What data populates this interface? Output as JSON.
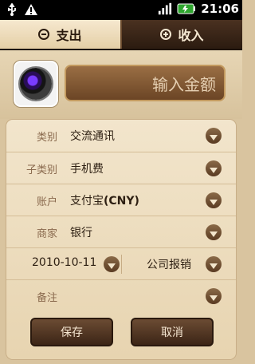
{
  "status_bar": {
    "time": "21:06",
    "icons": [
      "usb-icon",
      "warning-icon",
      "signal-icon",
      "battery-icon"
    ]
  },
  "tabs": [
    {
      "label": "支出",
      "active": true,
      "icon": "minus-circle-icon"
    },
    {
      "label": "收入",
      "active": false,
      "icon": "plus-circle-icon"
    }
  ],
  "amount": {
    "placeholder": "输入金额",
    "camera_icon": "camera-icon"
  },
  "form": {
    "rows": [
      {
        "label": "类别",
        "value": "交流通讯"
      },
      {
        "label": "子类别",
        "value": "手机费"
      },
      {
        "label": "账户",
        "value_main": "支付宝",
        "value_bold": "(CNY)"
      },
      {
        "label": "商家",
        "value": "银行"
      }
    ],
    "date_row": {
      "date": "2010-10-11",
      "tag": "公司报销"
    },
    "note_row": {
      "label": "备注",
      "value": ""
    }
  },
  "buttons": {
    "save": "保存",
    "cancel": "取消"
  },
  "colors": {
    "bg": "#d9c49f",
    "tab_active_bg": "#e4cfa6",
    "tab_inactive_bg": "#2b1b10",
    "input_bg": "#6b4525",
    "accent_dark": "#5a3b22"
  }
}
